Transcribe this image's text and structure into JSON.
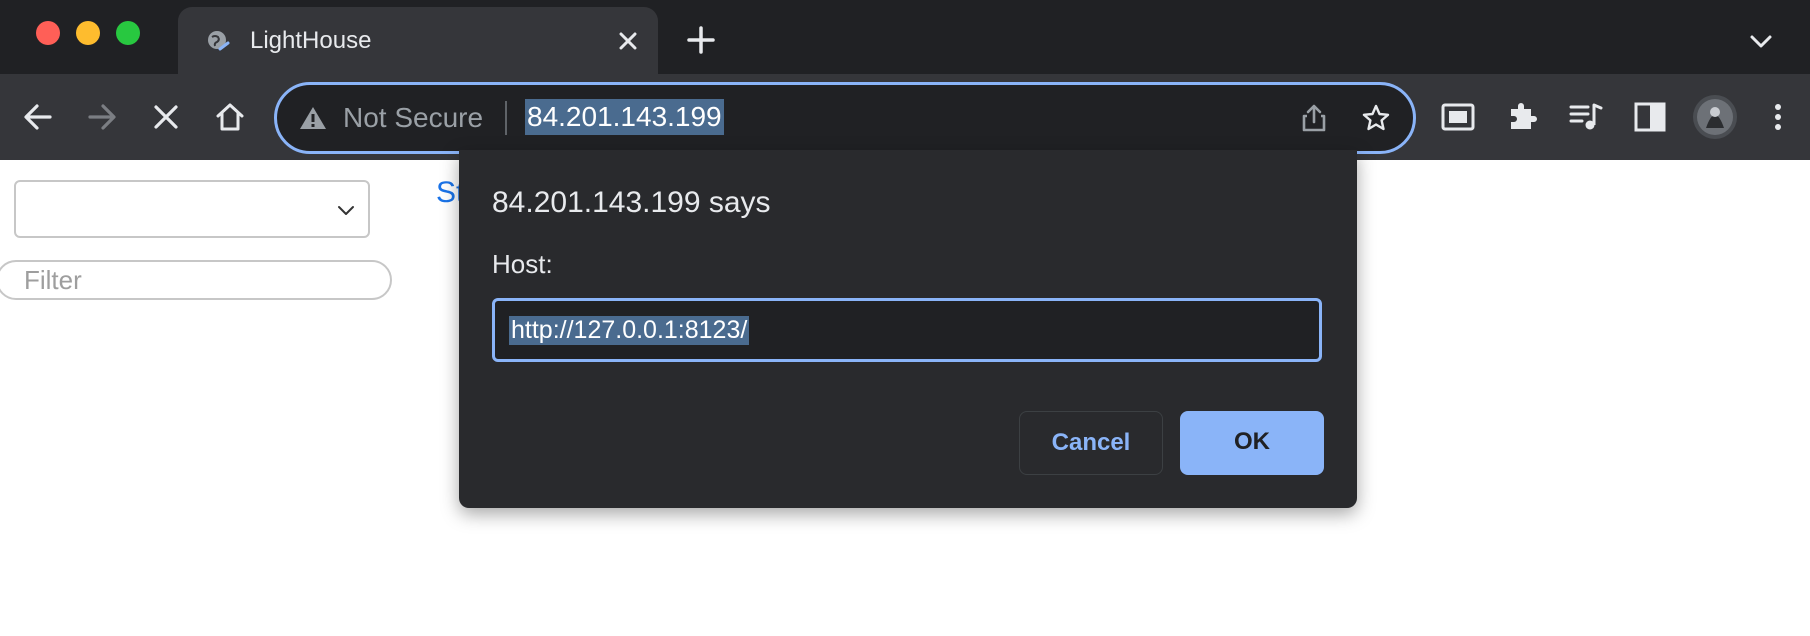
{
  "browser": {
    "tab": {
      "title": "LightHouse"
    },
    "omnibox": {
      "security_label": "Not Secure",
      "url": "84.201.143.199"
    },
    "colors": {
      "frame": "#202124",
      "toolbar": "#35363a",
      "accent": "#8ab4f8"
    }
  },
  "page": {
    "select_value": "",
    "filter_placeholder": "Filter",
    "link_text_partial": "St"
  },
  "dialog": {
    "title": "84.201.143.199 says",
    "label": "Host:",
    "input_value": "http://127.0.0.1:8123/",
    "cancel_label": "Cancel",
    "ok_label": "OK"
  }
}
